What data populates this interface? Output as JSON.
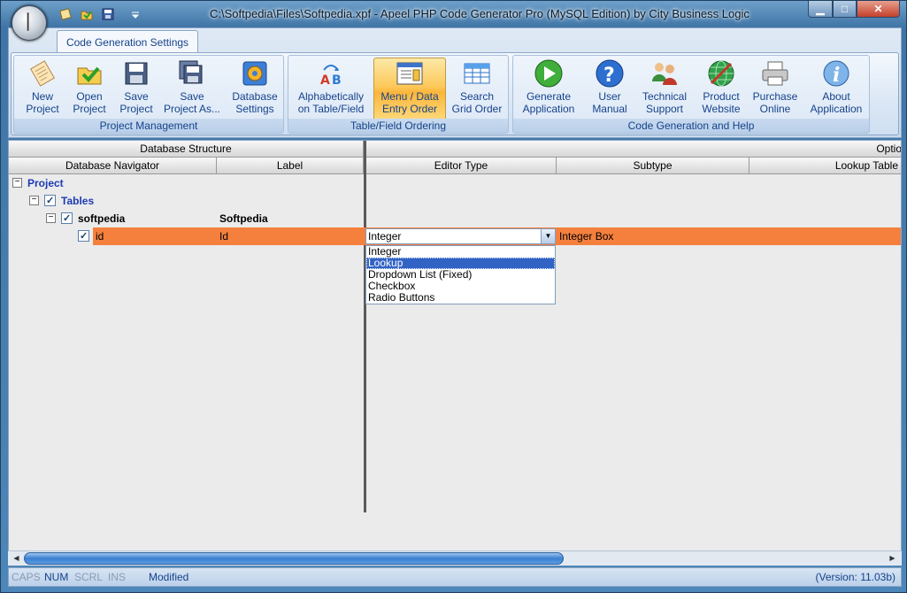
{
  "window": {
    "title": "C:\\Softpedia\\Files\\Softpedia.xpf - Apeel PHP Code Generator Pro (MySQL Edition) by City Business Logic",
    "min_icon": "minimize-icon",
    "max_icon": "maximize-icon",
    "close_icon": "close-icon"
  },
  "ribbon": {
    "tab": "Code Generation Settings",
    "groups": [
      {
        "label": "Project Management",
        "buttons": [
          {
            "label": "New\nProject",
            "icon": "new-project-icon"
          },
          {
            "label": "Open\nProject",
            "icon": "open-project-icon"
          },
          {
            "label": "Save\nProject",
            "icon": "save-icon"
          },
          {
            "label": "Save\nProject As...",
            "icon": "save-as-icon"
          },
          {
            "label": "Database\nSettings",
            "icon": "database-settings-icon"
          }
        ]
      },
      {
        "label": "Table/Field Ordering",
        "buttons": [
          {
            "label": "Alphabetically\non Table/Field",
            "icon": "alphabetical-sort-icon"
          },
          {
            "label": "Menu / Data\nEntry Order",
            "icon": "menu-order-icon"
          },
          {
            "label": "Search\nGrid Order",
            "icon": "grid-order-icon"
          }
        ]
      },
      {
        "label": "Code Generation and Help",
        "buttons": [
          {
            "label": "Generate\nApplication",
            "icon": "play-icon"
          },
          {
            "label": "User\nManual",
            "icon": "help-icon"
          },
          {
            "label": "Technical\nSupport",
            "icon": "support-people-icon"
          },
          {
            "label": "Product\nWebsite",
            "icon": "globe-icon"
          },
          {
            "label": "Purchase\nOnline",
            "icon": "printer-icon"
          },
          {
            "label": "About\nApplication",
            "icon": "info-icon"
          }
        ]
      }
    ]
  },
  "grid": {
    "group_headers": [
      "Database Structure",
      "Optio"
    ],
    "columns": [
      "Database Navigator",
      "Label",
      "Editor Type",
      "Subtype",
      "Lookup Table"
    ],
    "tree": {
      "project": "Project",
      "tables": "Tables",
      "table_name": "softpedia",
      "table_label": "Softpedia",
      "field_name": "id",
      "field_label": "Id"
    },
    "editor_type_value": "Integer",
    "subtype_value": "Integer Box",
    "editor_type_options": [
      "Integer",
      "Lookup",
      "Dropdown List (Fixed)",
      "Checkbox",
      "Radio Buttons"
    ],
    "selected_option": "Lookup"
  },
  "status": {
    "caps": "CAPS",
    "num": "NUM",
    "scrl": "SCRL",
    "ins": "INS",
    "state": "Modified",
    "version": "(Version: 11.03b)"
  },
  "colors": {
    "selected_row": "#f5803e",
    "ribbon_text": "#15428b",
    "tree_link": "#1d3bb3"
  }
}
